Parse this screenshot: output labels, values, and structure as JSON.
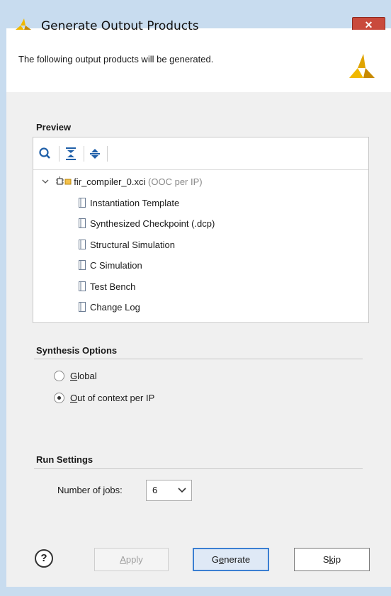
{
  "window": {
    "title": "Generate Output Products",
    "close_label": "✕"
  },
  "header": {
    "description": "The following output products will be generated."
  },
  "preview": {
    "section_label": "Preview",
    "toolbar": {
      "search_icon": "search-icon",
      "collapse_all_icon": "collapse-all-icon",
      "expand_all_icon": "expand-all-icon"
    },
    "root": {
      "name": "fir_compiler_0.xci",
      "suffix": "(OOC per IP)"
    },
    "children": [
      {
        "label": "Instantiation Template"
      },
      {
        "label": "Synthesized Checkpoint (.dcp)"
      },
      {
        "label": "Structural Simulation"
      },
      {
        "label": "C Simulation"
      },
      {
        "label": "Test Bench"
      },
      {
        "label": "Change Log"
      }
    ]
  },
  "synthesis_options": {
    "section_label": "Synthesis Options",
    "global_mnemonic": "G",
    "global_rest": "lobal",
    "ooc_mnemonic": "O",
    "ooc_rest": "ut of context per IP",
    "selected": "Out of context per IP"
  },
  "run_settings": {
    "section_label": "Run Settings",
    "jobs_label_pre": "Number of ",
    "jobs_label_mnemonic": "j",
    "jobs_label_post": "obs:",
    "jobs_value": "6"
  },
  "buttons": {
    "help": "?",
    "apply_mnemonic": "A",
    "apply_rest": "pply",
    "generate_pre": "G",
    "generate_mnemonic": "e",
    "generate_post": "nerate",
    "skip_pre": "S",
    "skip_mnemonic": "k",
    "skip_post": "ip"
  },
  "colors": {
    "frame": "#c8dcef",
    "close": "#c94a3c",
    "accent": "#3b7fd2",
    "logo": "#f0b800"
  }
}
